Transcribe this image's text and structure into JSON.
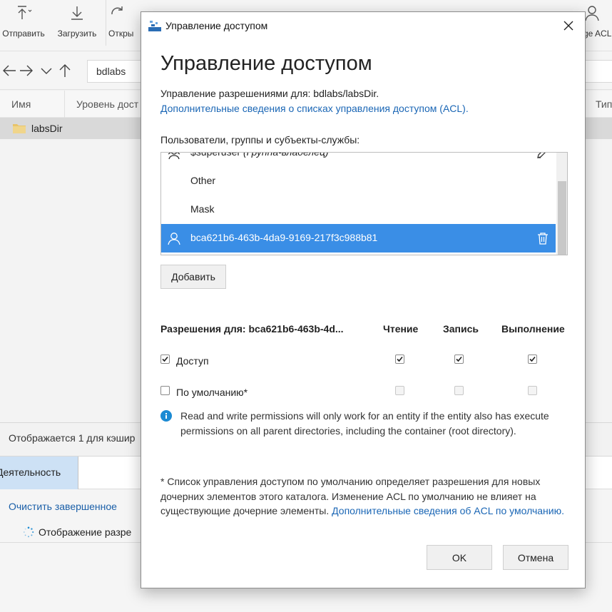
{
  "toolbar": {
    "items": [
      {
        "label": "Отправить",
        "icon": "upload-icon"
      },
      {
        "label": "Загрузить",
        "icon": "download-icon"
      },
      {
        "label": "Откры",
        "icon": "open-icon"
      },
      {
        "label": "ge ACL",
        "icon": "user-icon"
      }
    ]
  },
  "nav": {
    "address": "bdlabs"
  },
  "columns": {
    "name": "Имя",
    "access_level": "Уровень дост",
    "type": "Тип"
  },
  "files": [
    {
      "name": "labsDir",
      "icon": "folder-icon"
    }
  ],
  "status_text": "Отображается 1 для кэшир",
  "activity": {
    "tab_label": "Деятельность",
    "clear_link": "Очистить завершенное",
    "item_text": "Отображение разре"
  },
  "dialog": {
    "titlebar": "Управление доступом",
    "heading": "Управление доступом",
    "perm_for_line": "Управление разрешениями для: bdlabs/labsDir.",
    "acl_info_link": "Дополнительные сведения о списках управления доступом (ACL).",
    "principals_label": "Пользователи, группы и субъекты-службы:",
    "principals": [
      {
        "name": "$superuser",
        "suffix": "(Группа-владелец)",
        "icon": "group-icon",
        "action_icon": "edit-icon",
        "selected": false
      },
      {
        "name": "Other",
        "suffix": "",
        "icon": "",
        "action_icon": "",
        "selected": false
      },
      {
        "name": "Mask",
        "suffix": "",
        "icon": "",
        "action_icon": "",
        "selected": false
      },
      {
        "name": "bca621b6-463b-4da9-9169-217f3c988b81",
        "suffix": "",
        "icon": "user-icon",
        "action_icon": "trash-icon",
        "selected": true
      }
    ],
    "add_button": "Добавить",
    "permissions": {
      "header_label": "Разрешения для: bca621b6-463b-4d...",
      "col_read": "Чтение",
      "col_write": "Запись",
      "col_execute": "Выполнение",
      "rows": [
        {
          "label": "Доступ",
          "enabled": true,
          "read": true,
          "write": true,
          "execute": true
        },
        {
          "label": "По умолчанию*",
          "enabled": false,
          "read": false,
          "write": false,
          "execute": false
        }
      ]
    },
    "info_text": "Read and write permissions will only work for an entity if the entity also has execute permissions on all parent directories, including the container (root directory).",
    "default_note": "* Список управления доступом по умолчанию определяет разрешения для новых дочерних элементов этого каталога. Изменение ACL по умолчанию не влияет на существующие дочерние элементы.",
    "default_note_link": "Дополнительные сведения об ACL по умолчанию.",
    "ok_button": "OK",
    "cancel_button": "Отмена"
  },
  "colors": {
    "accent": "#3a8ee6",
    "link": "#1a66b5",
    "info": "#1b8ad3",
    "activity_tab": "#cde1f5"
  }
}
